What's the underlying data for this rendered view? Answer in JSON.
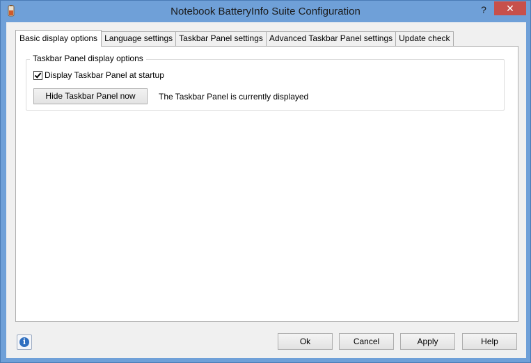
{
  "window": {
    "title": "Notebook BatteryInfo Suite Configuration",
    "help_glyph": "?",
    "close_glyph": "✕"
  },
  "tabs": [
    {
      "label": "Basic display options",
      "active": true
    },
    {
      "label": "Language settings",
      "active": false
    },
    {
      "label": "Taskbar Panel settings",
      "active": false
    },
    {
      "label": "Advanced Taskbar Panel settings",
      "active": false
    },
    {
      "label": "Update check",
      "active": false
    }
  ],
  "group": {
    "legend": "Taskbar Panel display options",
    "checkbox_label": "Display Taskbar Panel at startup",
    "checkbox_checked": true,
    "hide_button_label": "Hide Taskbar Panel now",
    "status_text": "The Taskbar Panel is currently displayed"
  },
  "footer": {
    "info_glyph": "i",
    "ok_label": "Ok",
    "cancel_label": "Cancel",
    "apply_label": "Apply",
    "help_label": "Help"
  },
  "colors": {
    "titlebar": "#6fa0d8",
    "close_button": "#c7504b",
    "client_bg": "#f0f0f0",
    "info_icon": "#2f6fc0"
  },
  "icons": {
    "app": "battery-app-icon",
    "info": "info-icon",
    "check": "checkmark-icon"
  }
}
